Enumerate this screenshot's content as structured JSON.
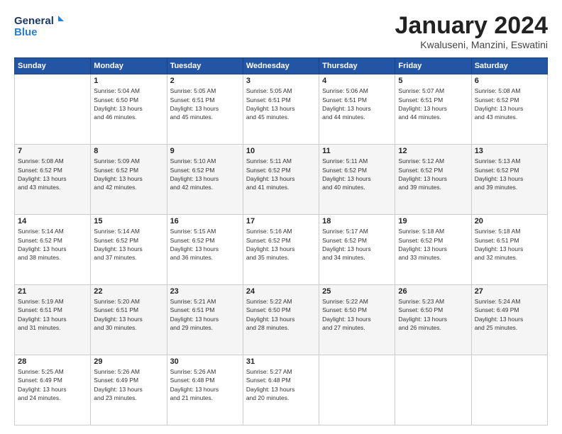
{
  "header": {
    "logo_line1": "General",
    "logo_line2": "Blue",
    "title": "January 2024",
    "subtitle": "Kwaluseni, Manzini, Eswatini"
  },
  "weekdays": [
    "Sunday",
    "Monday",
    "Tuesday",
    "Wednesday",
    "Thursday",
    "Friday",
    "Saturday"
  ],
  "weeks": [
    [
      {
        "day": "",
        "info": ""
      },
      {
        "day": "1",
        "info": "Sunrise: 5:04 AM\nSunset: 6:50 PM\nDaylight: 13 hours\nand 46 minutes."
      },
      {
        "day": "2",
        "info": "Sunrise: 5:05 AM\nSunset: 6:51 PM\nDaylight: 13 hours\nand 45 minutes."
      },
      {
        "day": "3",
        "info": "Sunrise: 5:05 AM\nSunset: 6:51 PM\nDaylight: 13 hours\nand 45 minutes."
      },
      {
        "day": "4",
        "info": "Sunrise: 5:06 AM\nSunset: 6:51 PM\nDaylight: 13 hours\nand 44 minutes."
      },
      {
        "day": "5",
        "info": "Sunrise: 5:07 AM\nSunset: 6:51 PM\nDaylight: 13 hours\nand 44 minutes."
      },
      {
        "day": "6",
        "info": "Sunrise: 5:08 AM\nSunset: 6:52 PM\nDaylight: 13 hours\nand 43 minutes."
      }
    ],
    [
      {
        "day": "7",
        "info": "Sunrise: 5:08 AM\nSunset: 6:52 PM\nDaylight: 13 hours\nand 43 minutes."
      },
      {
        "day": "8",
        "info": "Sunrise: 5:09 AM\nSunset: 6:52 PM\nDaylight: 13 hours\nand 42 minutes."
      },
      {
        "day": "9",
        "info": "Sunrise: 5:10 AM\nSunset: 6:52 PM\nDaylight: 13 hours\nand 42 minutes."
      },
      {
        "day": "10",
        "info": "Sunrise: 5:11 AM\nSunset: 6:52 PM\nDaylight: 13 hours\nand 41 minutes."
      },
      {
        "day": "11",
        "info": "Sunrise: 5:11 AM\nSunset: 6:52 PM\nDaylight: 13 hours\nand 40 minutes."
      },
      {
        "day": "12",
        "info": "Sunrise: 5:12 AM\nSunset: 6:52 PM\nDaylight: 13 hours\nand 39 minutes."
      },
      {
        "day": "13",
        "info": "Sunrise: 5:13 AM\nSunset: 6:52 PM\nDaylight: 13 hours\nand 39 minutes."
      }
    ],
    [
      {
        "day": "14",
        "info": "Sunrise: 5:14 AM\nSunset: 6:52 PM\nDaylight: 13 hours\nand 38 minutes."
      },
      {
        "day": "15",
        "info": "Sunrise: 5:14 AM\nSunset: 6:52 PM\nDaylight: 13 hours\nand 37 minutes."
      },
      {
        "day": "16",
        "info": "Sunrise: 5:15 AM\nSunset: 6:52 PM\nDaylight: 13 hours\nand 36 minutes."
      },
      {
        "day": "17",
        "info": "Sunrise: 5:16 AM\nSunset: 6:52 PM\nDaylight: 13 hours\nand 35 minutes."
      },
      {
        "day": "18",
        "info": "Sunrise: 5:17 AM\nSunset: 6:52 PM\nDaylight: 13 hours\nand 34 minutes."
      },
      {
        "day": "19",
        "info": "Sunrise: 5:18 AM\nSunset: 6:52 PM\nDaylight: 13 hours\nand 33 minutes."
      },
      {
        "day": "20",
        "info": "Sunrise: 5:18 AM\nSunset: 6:51 PM\nDaylight: 13 hours\nand 32 minutes."
      }
    ],
    [
      {
        "day": "21",
        "info": "Sunrise: 5:19 AM\nSunset: 6:51 PM\nDaylight: 13 hours\nand 31 minutes."
      },
      {
        "day": "22",
        "info": "Sunrise: 5:20 AM\nSunset: 6:51 PM\nDaylight: 13 hours\nand 30 minutes."
      },
      {
        "day": "23",
        "info": "Sunrise: 5:21 AM\nSunset: 6:51 PM\nDaylight: 13 hours\nand 29 minutes."
      },
      {
        "day": "24",
        "info": "Sunrise: 5:22 AM\nSunset: 6:50 PM\nDaylight: 13 hours\nand 28 minutes."
      },
      {
        "day": "25",
        "info": "Sunrise: 5:22 AM\nSunset: 6:50 PM\nDaylight: 13 hours\nand 27 minutes."
      },
      {
        "day": "26",
        "info": "Sunrise: 5:23 AM\nSunset: 6:50 PM\nDaylight: 13 hours\nand 26 minutes."
      },
      {
        "day": "27",
        "info": "Sunrise: 5:24 AM\nSunset: 6:49 PM\nDaylight: 13 hours\nand 25 minutes."
      }
    ],
    [
      {
        "day": "28",
        "info": "Sunrise: 5:25 AM\nSunset: 6:49 PM\nDaylight: 13 hours\nand 24 minutes."
      },
      {
        "day": "29",
        "info": "Sunrise: 5:26 AM\nSunset: 6:49 PM\nDaylight: 13 hours\nand 23 minutes."
      },
      {
        "day": "30",
        "info": "Sunrise: 5:26 AM\nSunset: 6:48 PM\nDaylight: 13 hours\nand 21 minutes."
      },
      {
        "day": "31",
        "info": "Sunrise: 5:27 AM\nSunset: 6:48 PM\nDaylight: 13 hours\nand 20 minutes."
      },
      {
        "day": "",
        "info": ""
      },
      {
        "day": "",
        "info": ""
      },
      {
        "day": "",
        "info": ""
      }
    ]
  ]
}
